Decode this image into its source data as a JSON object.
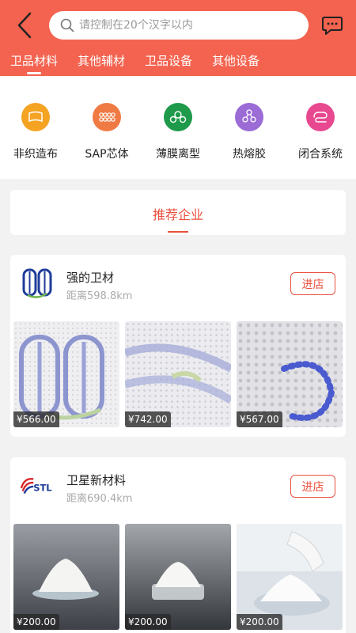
{
  "header": {
    "search_placeholder": "请控制在20个汉字以内",
    "tabs": [
      {
        "label": "卫品材料",
        "active": true
      },
      {
        "label": "其他辅材",
        "active": false
      },
      {
        "label": "卫品设备",
        "active": false
      },
      {
        "label": "其他设备",
        "active": false
      }
    ],
    "icons": {
      "back": "chevron-left-icon",
      "search": "search-icon",
      "message": "chat-bubble-icon"
    }
  },
  "colors": {
    "accent": "#f3634f",
    "accent_text": "#e9503f"
  },
  "categories": [
    {
      "label": "非织造布",
      "icon": "fabric-icon",
      "color": "#f5a323"
    },
    {
      "label": "SAP芯体",
      "icon": "sap-core-icon",
      "color": "#ef7a43"
    },
    {
      "label": "薄膜离型",
      "icon": "film-roll-icon",
      "color": "#1e9a4a"
    },
    {
      "label": "热熔胶",
      "icon": "molecule-icon",
      "color": "#9b6bd6"
    },
    {
      "label": "闭合系统",
      "icon": "closure-icon",
      "color": "#e8488f"
    }
  ],
  "recommend": {
    "title": "推荐企业"
  },
  "stores": [
    {
      "name": "强的卫材",
      "distance": "距离598.8km",
      "visit_label": "进店",
      "products": [
        {
          "price": "¥566.00"
        },
        {
          "price": "¥742.00"
        },
        {
          "price": "¥567.00"
        }
      ]
    },
    {
      "name": "卫星新材料",
      "distance": "距离690.4km",
      "visit_label": "进店",
      "logo_text": "STL",
      "products": [
        {
          "price": "¥200.00"
        },
        {
          "price": "¥200.00"
        },
        {
          "price": "¥200.00"
        }
      ]
    }
  ]
}
